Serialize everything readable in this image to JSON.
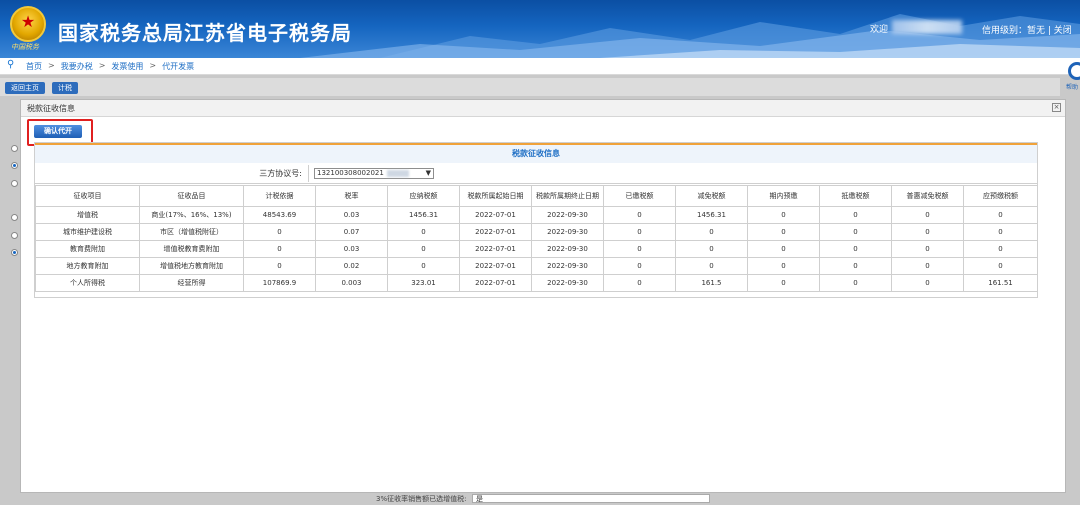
{
  "header": {
    "title": "国家税务总局江苏省电子税务局",
    "seal_text": "中国税务",
    "welcome": "欢迎",
    "credit": "信用级别：暂无 | 关闭"
  },
  "breadcrumb": {
    "items": [
      "首页",
      "我要办税",
      "发票使用",
      "代开发票"
    ],
    "separator": ">"
  },
  "background": {
    "btn_home": "返回主页",
    "btn_calc": "计税",
    "bottom_label": "3%征收率销售额已选增值税:",
    "bottom_value": "是",
    "help_label": "帮助"
  },
  "dialog": {
    "title": "税款征收信息",
    "confirm_button": "确认代开",
    "panel_title": "税款征收信息",
    "agreement_label": "三方协议号:",
    "agreement_value": "132100308002021"
  },
  "table": {
    "headers": [
      "征收项目",
      "征收品目",
      "计税依据",
      "税率",
      "应纳税额",
      "税款所属起始日期",
      "税款所属期终止日期",
      "已缴税额",
      "减免税额",
      "期内预缴",
      "抵缴税额",
      "普惠减免税额",
      "应预缴税额"
    ],
    "rows": [
      [
        "增值税",
        "商业(17%、16%、13%)",
        "48543.69",
        "0.03",
        "1456.31",
        "2022-07-01",
        "2022-09-30",
        "0",
        "1456.31",
        "0",
        "0",
        "0",
        "0"
      ],
      [
        "城市维护建设税",
        "市区（增值税附征）",
        "0",
        "0.07",
        "0",
        "2022-07-01",
        "2022-09-30",
        "0",
        "0",
        "0",
        "0",
        "0",
        "0"
      ],
      [
        "教育费附加",
        "增值税教育费附加",
        "0",
        "0.03",
        "0",
        "2022-07-01",
        "2022-09-30",
        "0",
        "0",
        "0",
        "0",
        "0",
        "0"
      ],
      [
        "地方教育附加",
        "增值税地方教育附加",
        "0",
        "0.02",
        "0",
        "2022-07-01",
        "2022-09-30",
        "0",
        "0",
        "0",
        "0",
        "0",
        "0"
      ],
      [
        "个人所得税",
        "经营所得",
        "107869.9",
        "0.003",
        "323.01",
        "2022-07-01",
        "2022-09-30",
        "0",
        "161.5",
        "0",
        "0",
        "0",
        "161.51"
      ]
    ]
  },
  "colors": {
    "header_blue": "#1565c0",
    "link_blue": "#1f6fc5",
    "button_blue": "#1f5fb5",
    "highlight_red": "#e02020",
    "panel_accent": "#f0a23a"
  }
}
